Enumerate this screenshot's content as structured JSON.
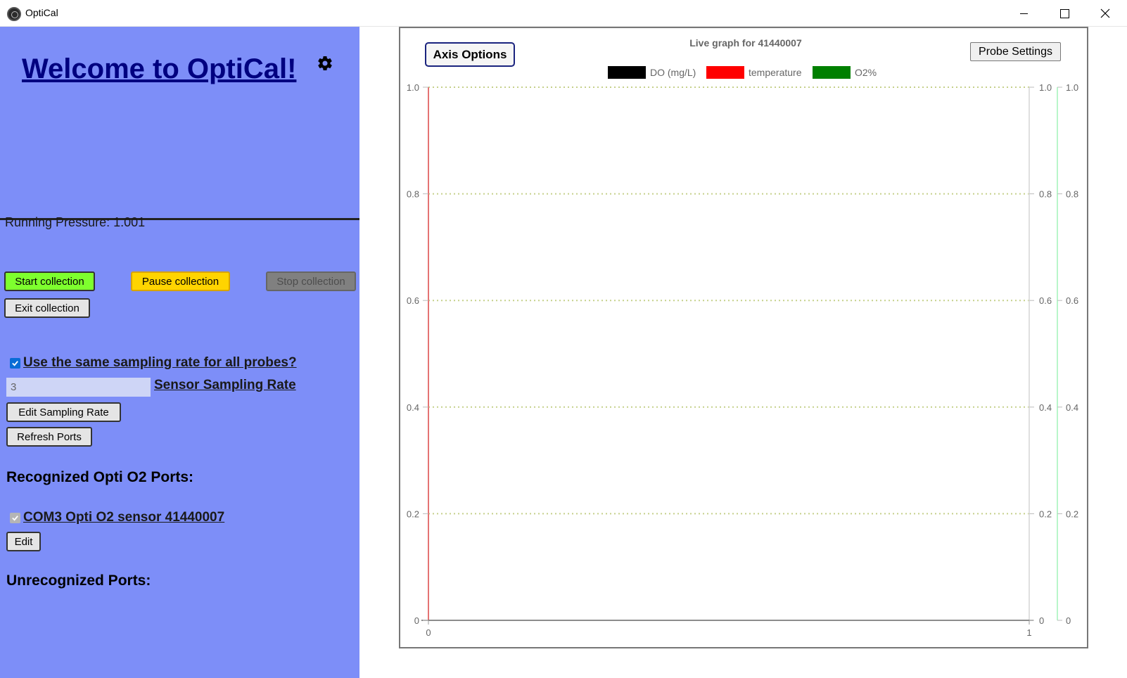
{
  "window": {
    "title": "OptiCal"
  },
  "left_panel": {
    "welcome": "Welcome to OptiCal!",
    "running_pressure": "Running Pressure: 1.001",
    "buttons": {
      "start": "Start collection",
      "pause": "Pause collection",
      "stop": "Stop collection",
      "exit": "Exit collection",
      "edit_rate": "Edit Sampling Rate",
      "refresh": "Refresh Ports",
      "edit": "Edit"
    },
    "same_rate_label": "Use the same sampling rate for all probes?",
    "same_rate_checked": true,
    "sampling_rate_value": "3",
    "sampling_rate_label": "Sensor Sampling Rate",
    "recognized_heading": "Recognized Opti O2 Ports:",
    "recognized_ports": [
      {
        "label": "COM3 Opti O2 sensor 41440007",
        "checked": true
      }
    ],
    "unrecognized_heading": "Unrecognized Ports:"
  },
  "graph": {
    "axis_options_label": "Axis Options",
    "probe_settings_label": "Probe Settings",
    "title": "Live graph for 41440007",
    "legend": [
      {
        "name": "DO (mg/L)",
        "color": "#000000"
      },
      {
        "name": "temperature",
        "color": "#ff0000"
      },
      {
        "name": "O2%",
        "color": "#008000"
      }
    ],
    "axis_colors": {
      "left": "#e57373",
      "right_inner": "#e0e0e0",
      "right_outer": "#b9f6ca",
      "grid": "#c5d08a"
    }
  },
  "chart_data": {
    "type": "line",
    "title": "Live graph for 41440007",
    "xlim": [
      0,
      1
    ],
    "x_ticks": [
      "0",
      "1"
    ],
    "y_axes": [
      {
        "ylim": [
          0,
          1
        ],
        "ticks": [
          "0",
          "0.2",
          "0.4",
          "0.6",
          "0.8",
          "1.0"
        ]
      },
      {
        "ylim": [
          0,
          1
        ],
        "ticks": [
          "0",
          "0.2",
          "0.4",
          "0.6",
          "0.8",
          "1.0"
        ]
      },
      {
        "ylim": [
          0,
          1
        ],
        "ticks": [
          "0",
          "0.2",
          "0.4",
          "0.6",
          "0.8",
          "1.0"
        ]
      }
    ],
    "series": [
      {
        "name": "DO (mg/L)",
        "values": []
      },
      {
        "name": "temperature",
        "values": []
      },
      {
        "name": "O2%",
        "values": []
      }
    ],
    "grid": true,
    "legend_position": "top"
  }
}
